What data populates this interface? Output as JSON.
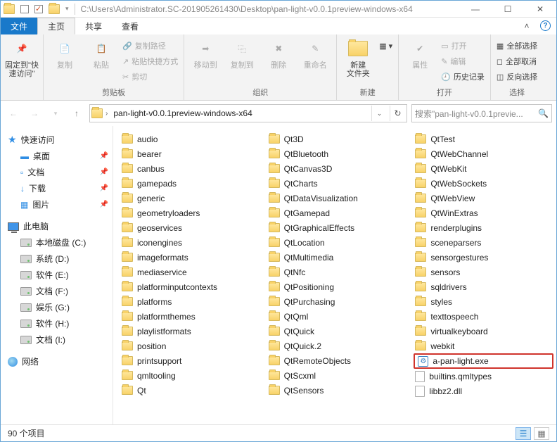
{
  "title_path": "C:\\Users\\Administrator.SC-201905261430\\Desktop\\pan-light-v0.0.1preview-windows-x64",
  "file_tab": "文件",
  "tabs": [
    "主页",
    "共享",
    "查看"
  ],
  "ribbon": {
    "pin": {
      "label": "固定到\"快\n速访问\"",
      "group": ""
    },
    "clipboard": {
      "copy": "复制",
      "paste": "粘贴",
      "copypath": "复制路径",
      "pasteshortcut": "粘贴快捷方式",
      "cut": "剪切",
      "group": "剪贴板"
    },
    "organize": {
      "moveto": "移动到",
      "copyto": "复制到",
      "delete": "删除",
      "rename": "重命名",
      "group": "组织"
    },
    "new": {
      "newfolder": "新建\n文件夹",
      "group": "新建"
    },
    "open": {
      "props": "属性",
      "open": "打开",
      "edit": "编辑",
      "history": "历史记录",
      "group": "打开"
    },
    "select": {
      "selectall": "全部选择",
      "selectnone": "全部取消",
      "invert": "反向选择",
      "group": "选择"
    }
  },
  "breadcrumb": "pan-light-v0.0.1preview-windows-x64",
  "search_placeholder": "搜索\"pan-light-v0.0.1previe...",
  "nav": {
    "quick": "快速访问",
    "desktop": "桌面",
    "documents": "文档",
    "downloads": "下载",
    "pictures": "图片",
    "thispc": "此电脑",
    "drives": [
      {
        "label": "本地磁盘 (C:)"
      },
      {
        "label": "系统 (D:)"
      },
      {
        "label": "软件 (E:)"
      },
      {
        "label": "文档 (F:)"
      },
      {
        "label": "娱乐 (G:)"
      },
      {
        "label": "软件 (H:)"
      },
      {
        "label": "文档 (I:)"
      }
    ],
    "network": "网络"
  },
  "columns": [
    [
      "audio",
      "bearer",
      "canbus",
      "gamepads",
      "generic",
      "geometryloaders",
      "geoservices",
      "iconengines",
      "imageformats",
      "mediaservice",
      "platforminputcontexts",
      "platforms",
      "platformthemes",
      "playlistformats",
      "position",
      "printsupport",
      "qmltooling",
      "Qt"
    ],
    [
      "Qt3D",
      "QtBluetooth",
      "QtCanvas3D",
      "QtCharts",
      "QtDataVisualization",
      "QtGamepad",
      "QtGraphicalEffects",
      "QtLocation",
      "QtMultimedia",
      "QtNfc",
      "QtPositioning",
      "QtPurchasing",
      "QtQml",
      "QtQuick",
      "QtQuick.2",
      "QtRemoteObjects",
      "QtScxml",
      "QtSensors"
    ],
    [
      "QtTest",
      "QtWebChannel",
      "QtWebKit",
      "QtWebSockets",
      "QtWebView",
      "QtWinExtras",
      "renderplugins",
      "sceneparsers",
      "sensorgestures",
      "sensors",
      "sqldrivers",
      "styles",
      "texttospeech",
      "virtualkeyboard",
      "webkit"
    ]
  ],
  "files_col3": [
    {
      "name": "a-pan-light.exe",
      "type": "exe",
      "hl": true
    },
    {
      "name": "builtins.qmltypes",
      "type": "file"
    },
    {
      "name": "libbz2.dll",
      "type": "file"
    }
  ],
  "status": "90 个项目"
}
